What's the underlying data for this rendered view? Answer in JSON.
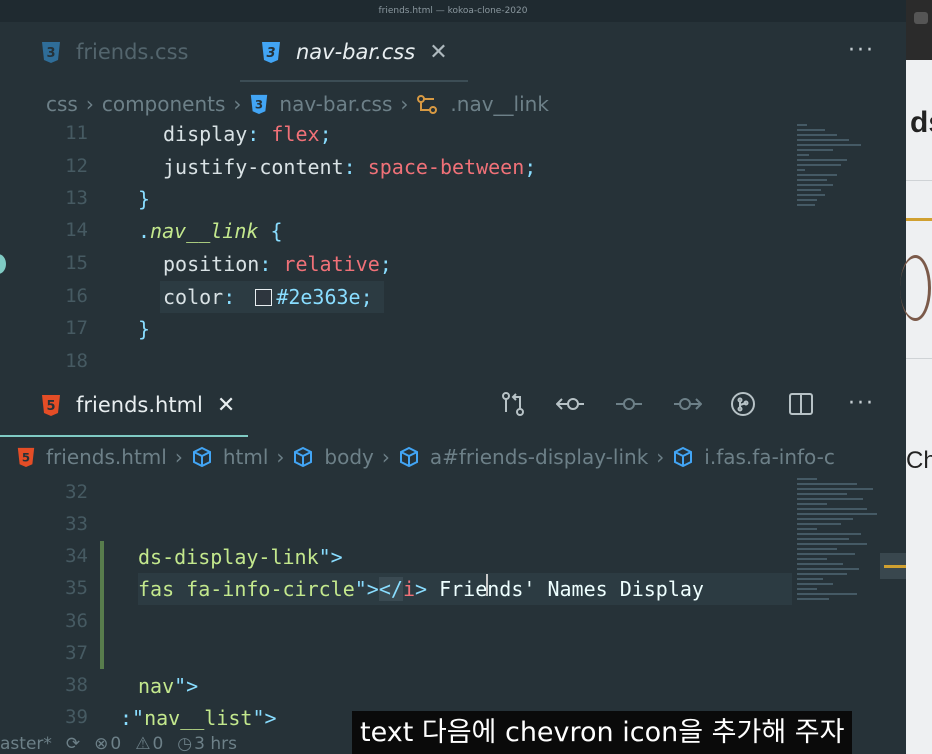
{
  "window": {
    "title": "friends.html — kokoa-clone-2020"
  },
  "top_editor": {
    "tabs": [
      {
        "label": "friends.css",
        "active": false
      },
      {
        "label": "nav-bar.css",
        "active": true
      }
    ],
    "breadcrumb": [
      "css",
      "components",
      "nav-bar.css",
      ".nav__link"
    ],
    "lines": [
      {
        "num": "11",
        "text": "display: flex;"
      },
      {
        "num": "12",
        "text": "justify-content: space-between;"
      },
      {
        "num": "13",
        "text": "}"
      },
      {
        "num": "14",
        "text": ".nav__link {"
      },
      {
        "num": "15",
        "text": "position: relative;"
      },
      {
        "num": "16",
        "text": "color: #2e363e;"
      },
      {
        "num": "17",
        "text": "}"
      },
      {
        "num": "18",
        "text": ""
      }
    ],
    "tokens": {
      "l11_prop": "display",
      "l11_colon": ": ",
      "l11_val": "flex",
      "l11_semi": ";",
      "l12_prop": "justify-content",
      "l12_colon": ": ",
      "l12_val": "space-between",
      "l12_semi": ";",
      "l13_brace": "}",
      "l14_dot": ".",
      "l14_sel": "nav__link",
      "l14_brace": " {",
      "l15_prop": "position",
      "l15_colon": ": ",
      "l15_val": "relative",
      "l15_semi": ";",
      "l16_prop": "color",
      "l16_colon": ": ",
      "l16_val": "#2e363e",
      "l16_semi": ";",
      "l17_brace": "}"
    },
    "color_swatch": "#2e363e"
  },
  "bottom_editor": {
    "tab": {
      "label": "friends.html"
    },
    "breadcrumb": [
      "friends.html",
      "html",
      "body",
      "a#friends-display-link",
      "i.fas.fa-info-c"
    ],
    "line_numbers": [
      "32",
      "33",
      "34",
      "35",
      "36",
      "37",
      "38",
      "39"
    ],
    "tokens": {
      "l34_a": "ds-display-link",
      "l34_b": "\">",
      "l35_a": "fas fa-info-circle",
      "l35_b": "\">",
      "l35_c": "</",
      "l35_d": "i",
      "l35_e": ">",
      "l35_f": " Friends' Names Display",
      "l38_a": "nav",
      "l38_b": "\">",
      "l39_a": ":\"",
      "l39_b": "nav__list",
      "l39_c": "\">"
    }
  },
  "status_bar": {
    "branch": "aster*",
    "errors": "0",
    "warnings": "0",
    "time": "3 hrs"
  },
  "subtitle": "text 다음에 chevron icon을 추가해 주자",
  "external": {
    "text1": "ds",
    "text2": "Ch"
  },
  "colors": {
    "bg": "#263238",
    "accent": "#80cbc4",
    "css_icon": "#42a5f5",
    "html_icon": "#e44d26"
  }
}
